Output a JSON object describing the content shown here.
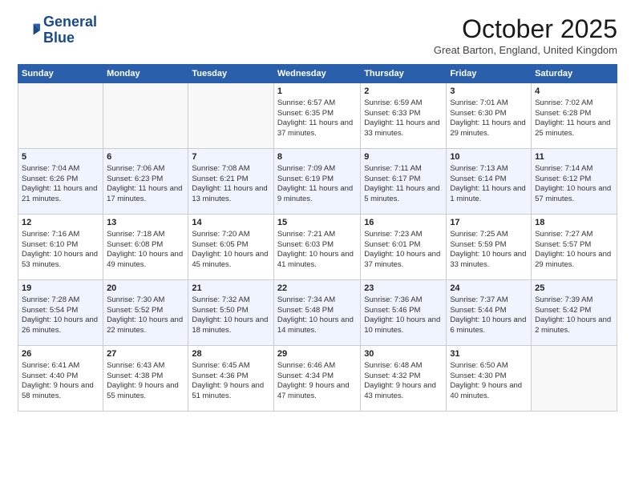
{
  "header": {
    "logo_line1": "General",
    "logo_line2": "Blue",
    "month": "October 2025",
    "location": "Great Barton, England, United Kingdom"
  },
  "weekdays": [
    "Sunday",
    "Monday",
    "Tuesday",
    "Wednesday",
    "Thursday",
    "Friday",
    "Saturday"
  ],
  "weeks": [
    [
      {
        "day": "",
        "info": ""
      },
      {
        "day": "",
        "info": ""
      },
      {
        "day": "",
        "info": ""
      },
      {
        "day": "1",
        "info": "Sunrise: 6:57 AM\nSunset: 6:35 PM\nDaylight: 11 hours and 37 minutes."
      },
      {
        "day": "2",
        "info": "Sunrise: 6:59 AM\nSunset: 6:33 PM\nDaylight: 11 hours and 33 minutes."
      },
      {
        "day": "3",
        "info": "Sunrise: 7:01 AM\nSunset: 6:30 PM\nDaylight: 11 hours and 29 minutes."
      },
      {
        "day": "4",
        "info": "Sunrise: 7:02 AM\nSunset: 6:28 PM\nDaylight: 11 hours and 25 minutes."
      }
    ],
    [
      {
        "day": "5",
        "info": "Sunrise: 7:04 AM\nSunset: 6:26 PM\nDaylight: 11 hours and 21 minutes."
      },
      {
        "day": "6",
        "info": "Sunrise: 7:06 AM\nSunset: 6:23 PM\nDaylight: 11 hours and 17 minutes."
      },
      {
        "day": "7",
        "info": "Sunrise: 7:08 AM\nSunset: 6:21 PM\nDaylight: 11 hours and 13 minutes."
      },
      {
        "day": "8",
        "info": "Sunrise: 7:09 AM\nSunset: 6:19 PM\nDaylight: 11 hours and 9 minutes."
      },
      {
        "day": "9",
        "info": "Sunrise: 7:11 AM\nSunset: 6:17 PM\nDaylight: 11 hours and 5 minutes."
      },
      {
        "day": "10",
        "info": "Sunrise: 7:13 AM\nSunset: 6:14 PM\nDaylight: 11 hours and 1 minute."
      },
      {
        "day": "11",
        "info": "Sunrise: 7:14 AM\nSunset: 6:12 PM\nDaylight: 10 hours and 57 minutes."
      }
    ],
    [
      {
        "day": "12",
        "info": "Sunrise: 7:16 AM\nSunset: 6:10 PM\nDaylight: 10 hours and 53 minutes."
      },
      {
        "day": "13",
        "info": "Sunrise: 7:18 AM\nSunset: 6:08 PM\nDaylight: 10 hours and 49 minutes."
      },
      {
        "day": "14",
        "info": "Sunrise: 7:20 AM\nSunset: 6:05 PM\nDaylight: 10 hours and 45 minutes."
      },
      {
        "day": "15",
        "info": "Sunrise: 7:21 AM\nSunset: 6:03 PM\nDaylight: 10 hours and 41 minutes."
      },
      {
        "day": "16",
        "info": "Sunrise: 7:23 AM\nSunset: 6:01 PM\nDaylight: 10 hours and 37 minutes."
      },
      {
        "day": "17",
        "info": "Sunrise: 7:25 AM\nSunset: 5:59 PM\nDaylight: 10 hours and 33 minutes."
      },
      {
        "day": "18",
        "info": "Sunrise: 7:27 AM\nSunset: 5:57 PM\nDaylight: 10 hours and 29 minutes."
      }
    ],
    [
      {
        "day": "19",
        "info": "Sunrise: 7:28 AM\nSunset: 5:54 PM\nDaylight: 10 hours and 26 minutes."
      },
      {
        "day": "20",
        "info": "Sunrise: 7:30 AM\nSunset: 5:52 PM\nDaylight: 10 hours and 22 minutes."
      },
      {
        "day": "21",
        "info": "Sunrise: 7:32 AM\nSunset: 5:50 PM\nDaylight: 10 hours and 18 minutes."
      },
      {
        "day": "22",
        "info": "Sunrise: 7:34 AM\nSunset: 5:48 PM\nDaylight: 10 hours and 14 minutes."
      },
      {
        "day": "23",
        "info": "Sunrise: 7:36 AM\nSunset: 5:46 PM\nDaylight: 10 hours and 10 minutes."
      },
      {
        "day": "24",
        "info": "Sunrise: 7:37 AM\nSunset: 5:44 PM\nDaylight: 10 hours and 6 minutes."
      },
      {
        "day": "25",
        "info": "Sunrise: 7:39 AM\nSunset: 5:42 PM\nDaylight: 10 hours and 2 minutes."
      }
    ],
    [
      {
        "day": "26",
        "info": "Sunrise: 6:41 AM\nSunset: 4:40 PM\nDaylight: 9 hours and 58 minutes."
      },
      {
        "day": "27",
        "info": "Sunrise: 6:43 AM\nSunset: 4:38 PM\nDaylight: 9 hours and 55 minutes."
      },
      {
        "day": "28",
        "info": "Sunrise: 6:45 AM\nSunset: 4:36 PM\nDaylight: 9 hours and 51 minutes."
      },
      {
        "day": "29",
        "info": "Sunrise: 6:46 AM\nSunset: 4:34 PM\nDaylight: 9 hours and 47 minutes."
      },
      {
        "day": "30",
        "info": "Sunrise: 6:48 AM\nSunset: 4:32 PM\nDaylight: 9 hours and 43 minutes."
      },
      {
        "day": "31",
        "info": "Sunrise: 6:50 AM\nSunset: 4:30 PM\nDaylight: 9 hours and 40 minutes."
      },
      {
        "day": "",
        "info": ""
      }
    ]
  ]
}
